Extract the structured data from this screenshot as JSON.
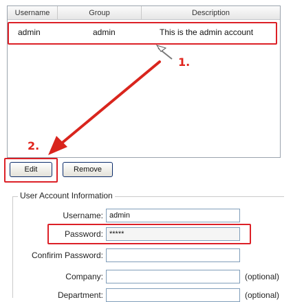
{
  "table": {
    "columns": [
      "Username",
      "Group",
      "Description"
    ],
    "rows": [
      {
        "username": "admin",
        "group": "admin",
        "description": "This is the admin account"
      }
    ]
  },
  "steps": {
    "step1": "1.",
    "step2": "2."
  },
  "buttons": {
    "edit": "Edit",
    "remove": "Remove"
  },
  "account": {
    "legend": "User Account Information",
    "fields": [
      {
        "label": "Username:",
        "value": "admin"
      },
      {
        "label": "Password:",
        "value": "*****"
      },
      {
        "label": "Confirim Password:",
        "value": ""
      },
      {
        "label": "Company:",
        "value": "",
        "note": "(optional)"
      },
      {
        "label": "Department:",
        "value": "",
        "note": "(optional)"
      }
    ]
  },
  "colors": {
    "highlight": "#dc1f26",
    "arrow": "#d9251d",
    "field_border": "#7f9db9"
  }
}
